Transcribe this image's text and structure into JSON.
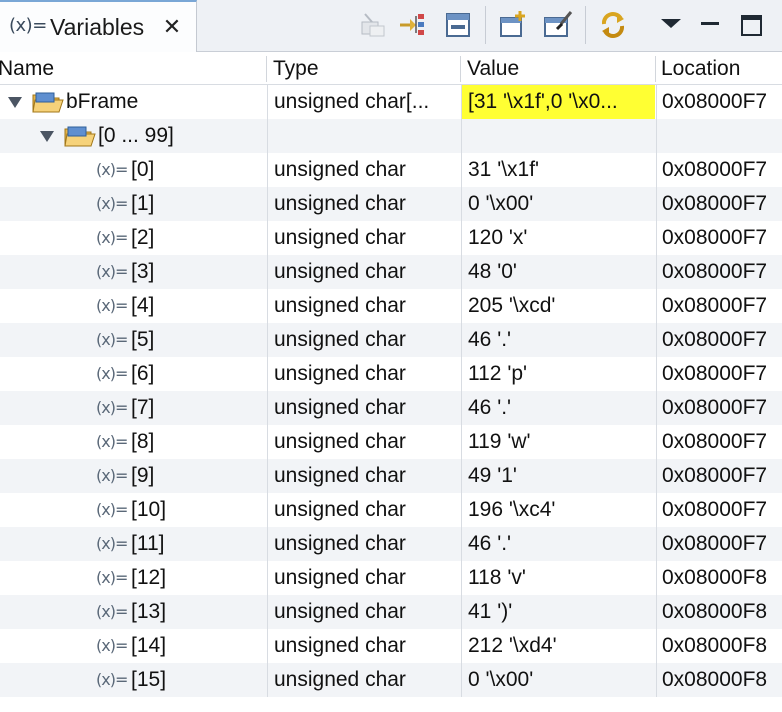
{
  "view": {
    "tab_title": "Variables",
    "tab_icon_text": "(x)=",
    "close_label": "✕",
    "toolbar": [
      {
        "name": "collapse-all-icon",
        "disabled": true
      },
      {
        "name": "show-logical-structure-icon",
        "disabled": false
      },
      {
        "name": "collapse-icon",
        "disabled": false
      },
      {
        "name": "add-watch-expression-icon",
        "disabled": false
      },
      {
        "name": "select-columns-icon",
        "disabled": false
      },
      {
        "name": "refresh-icon",
        "disabled": false
      },
      {
        "name": "view-menu-icon",
        "disabled": false
      },
      {
        "name": "minimize-icon",
        "disabled": false
      },
      {
        "name": "maximize-icon",
        "disabled": false
      }
    ]
  },
  "columns": {
    "name": "Name",
    "type": "Type",
    "value": "Value",
    "location": "Location"
  },
  "highlight_color": "#ffff33",
  "rows": [
    {
      "kind": "array",
      "level": 0,
      "name": "bFrame",
      "type": "unsigned char[...",
      "value": "[31 '\\x1f',0 '\\x0...",
      "location": "0x08000F7",
      "highlight": true
    },
    {
      "kind": "range",
      "level": 1,
      "name": "[0 ... 99]",
      "type": "",
      "value": "",
      "location": ""
    },
    {
      "kind": "var",
      "name": "[0]",
      "type": "unsigned char",
      "value": "31 '\\x1f'",
      "location": "0x08000F7"
    },
    {
      "kind": "var",
      "name": "[1]",
      "type": "unsigned char",
      "value": "0 '\\x00'",
      "location": "0x08000F7"
    },
    {
      "kind": "var",
      "name": "[2]",
      "type": "unsigned char",
      "value": "120 'x'",
      "location": "0x08000F7"
    },
    {
      "kind": "var",
      "name": "[3]",
      "type": "unsigned char",
      "value": "48 '0'",
      "location": "0x08000F7"
    },
    {
      "kind": "var",
      "name": "[4]",
      "type": "unsigned char",
      "value": "205 '\\xcd'",
      "location": "0x08000F7"
    },
    {
      "kind": "var",
      "name": "[5]",
      "type": "unsigned char",
      "value": "46 '.'",
      "location": "0x08000F7"
    },
    {
      "kind": "var",
      "name": "[6]",
      "type": "unsigned char",
      "value": "112 'p'",
      "location": "0x08000F7"
    },
    {
      "kind": "var",
      "name": "[7]",
      "type": "unsigned char",
      "value": "46 '.'",
      "location": "0x08000F7"
    },
    {
      "kind": "var",
      "name": "[8]",
      "type": "unsigned char",
      "value": "119 'w'",
      "location": "0x08000F7"
    },
    {
      "kind": "var",
      "name": "[9]",
      "type": "unsigned char",
      "value": "49 '1'",
      "location": "0x08000F7"
    },
    {
      "kind": "var",
      "name": "[10]",
      "type": "unsigned char",
      "value": "196 '\\xc4'",
      "location": "0x08000F7"
    },
    {
      "kind": "var",
      "name": "[11]",
      "type": "unsigned char",
      "value": "46 '.'",
      "location": "0x08000F7"
    },
    {
      "kind": "var",
      "name": "[12]",
      "type": "unsigned char",
      "value": "118 'v'",
      "location": "0x08000F8"
    },
    {
      "kind": "var",
      "name": "[13]",
      "type": "unsigned char",
      "value": "41 ')'",
      "location": "0x08000F8"
    },
    {
      "kind": "var",
      "name": "[14]",
      "type": "unsigned char",
      "value": "212 '\\xd4'",
      "location": "0x08000F8"
    },
    {
      "kind": "var",
      "name": "[15]",
      "type": "unsigned char",
      "value": "0 '\\x00'",
      "location": "0x08000F8"
    }
  ]
}
